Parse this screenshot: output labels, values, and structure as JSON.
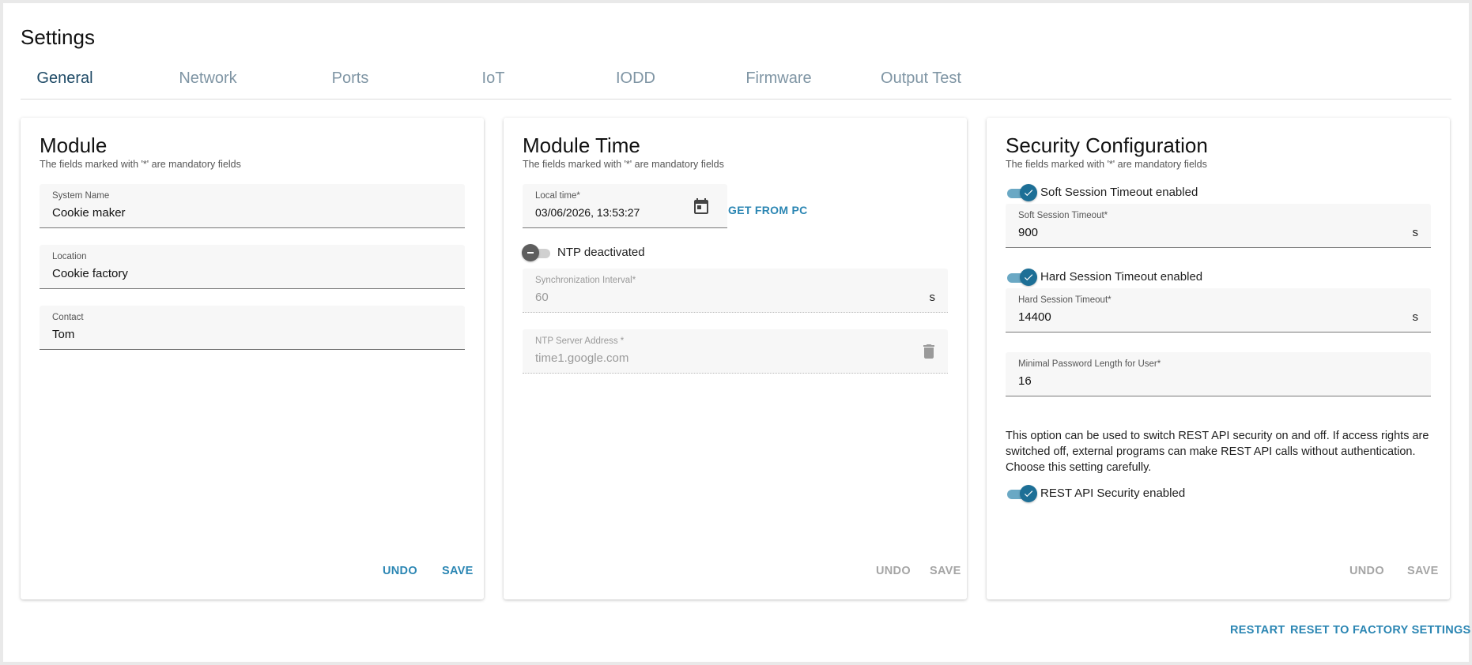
{
  "page": {
    "title": "Settings"
  },
  "tabs": [
    {
      "label": "General",
      "active": true
    },
    {
      "label": "Network"
    },
    {
      "label": "Ports"
    },
    {
      "label": "IoT"
    },
    {
      "label": "IODD"
    },
    {
      "label": "Firmware"
    },
    {
      "label": "Output Test"
    }
  ],
  "mandatory_note": "The fields marked with '*' are mandatory fields",
  "module": {
    "title": "Module",
    "system_name": {
      "label": "System Name",
      "value": "Cookie maker"
    },
    "location": {
      "label": "Location",
      "value": "Cookie factory"
    },
    "contact": {
      "label": "Contact",
      "value": "Tom"
    },
    "undo": "UNDO",
    "save": "SAVE"
  },
  "module_time": {
    "title": "Module Time",
    "local_time": {
      "label": "Local time*",
      "value": "03/06/2026, 13:53:27"
    },
    "get_from_pc": "GET FROM PC",
    "ntp_toggle": {
      "label": "NTP deactivated",
      "on": false
    },
    "sync_interval": {
      "label": "Synchronization Interval*",
      "value": "60",
      "unit": "s"
    },
    "ntp_server": {
      "label": "NTP Server Address *",
      "value": "time1.google.com"
    },
    "undo": "UNDO",
    "save": "SAVE"
  },
  "security": {
    "title": "Security Configuration",
    "soft_toggle": {
      "label": "Soft Session Timeout enabled",
      "on": true
    },
    "soft_timeout": {
      "label": "Soft Session Timeout*",
      "value": "900",
      "unit": "s"
    },
    "hard_toggle": {
      "label": "Hard Session Timeout enabled",
      "on": true
    },
    "hard_timeout": {
      "label": "Hard Session Timeout*",
      "value": "14400",
      "unit": "s"
    },
    "min_password": {
      "label": "Minimal Password Length for User*",
      "value": "16"
    },
    "rest_description": "This option can be used to switch REST API security on and off. If access rights are switched off, external programs can make REST API calls without authentication. Choose this setting carefully.",
    "rest_toggle": {
      "label": "REST API Security enabled",
      "on": true
    },
    "undo": "UNDO",
    "save": "SAVE"
  },
  "footer": {
    "restart": "RESTART",
    "reset": "RESET TO FACTORY SETTINGS"
  },
  "colors": {
    "accent": "#2b86b3",
    "active_tab": "#1e4a66",
    "inactive_tab": "#7f95a4",
    "switch_on": "#1d6f96"
  },
  "icons": {
    "calendar": "calendar-icon",
    "trash": "trash-icon",
    "check": "check-icon",
    "minus": "minus-icon"
  }
}
